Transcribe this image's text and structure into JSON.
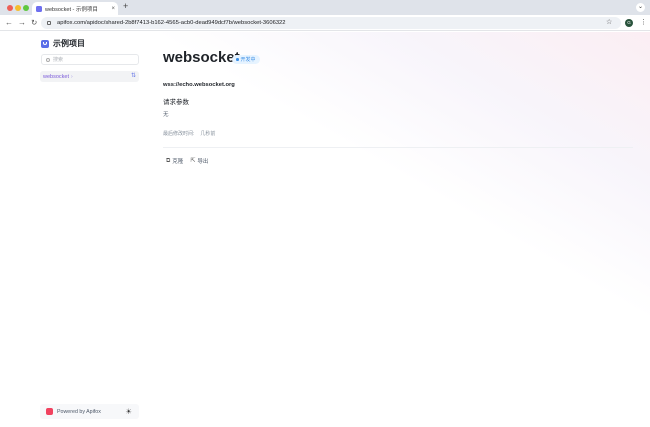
{
  "browser": {
    "tab_title": "websocket - 示例项目",
    "tab_close": "×",
    "new_tab": "+",
    "tabs_menu": "⌄",
    "url": "apifox.com/apidoc/shared-2b8f7413-b162-4565-acb0-dead949dcf7b/websocket-3606322",
    "profile_initial": "G"
  },
  "sidebar": {
    "project_name": "示例项目",
    "search_placeholder": "搜索",
    "tree_items": [
      {
        "label": "websocket",
        "chevron": "›"
      }
    ],
    "footer": {
      "powered_by": "Powered by Apifox"
    }
  },
  "main": {
    "title": "websocket",
    "status": "开发中",
    "url": "wss://echo.websocket.org",
    "section_title": "请求参数",
    "section_empty": "无",
    "last_modified_label": "最后修改时间:",
    "last_modified_value": "几秒前",
    "actions": {
      "clone": "克隆",
      "export": "导出"
    }
  },
  "colors": {
    "accent": "#7b5ad9",
    "status": "#3b8ee6",
    "brand": "#f1425f"
  },
  "icons": {
    "clone": "clone-icon",
    "export": "export-icon",
    "theme": "sun-icon"
  }
}
